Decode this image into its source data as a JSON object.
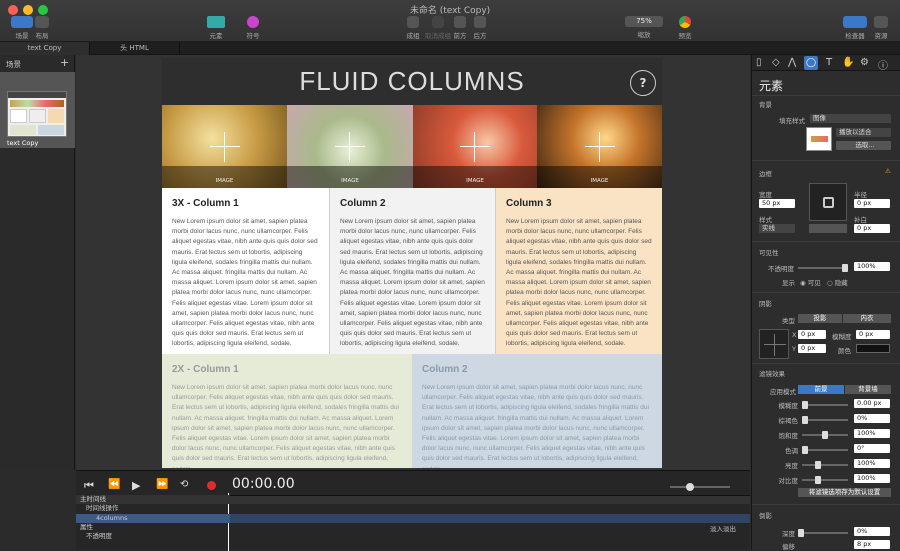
{
  "window": {
    "title": "未命名 (text Copy)"
  },
  "toolbar": {
    "scenes": "场景",
    "layout": "布局",
    "elements": "元素",
    "symbols": "符号",
    "group": "成组",
    "ungroup": "取消成组",
    "front": "前方",
    "back": "后方",
    "zoom_value": "75%",
    "zoom": "缩放",
    "preview": "预览",
    "inspector": "检查器",
    "library": "资源"
  },
  "tabs": [
    "text Copy",
    "头 HTML"
  ],
  "scenes_panel": {
    "title": "场景",
    "add": "+",
    "scene_name": "text Copy"
  },
  "page": {
    "title": "FLUID COLUMNS",
    "help": "?",
    "image_label": "IMAGE",
    "columns": [
      {
        "heading": "3X - Column 1",
        "text": "New Lorem ipsum dolor sit amet, sapien platea morbi dolor lacus nunc, nunc ullamcorper. Felis aliquet egestas vitae, nibh ante quis quis dolor sed mauris. Erat lectus sem ut lobortis, adipiscing ligula eleifend, sodales fringilla mattis dui nullam. Ac massa aliquet. fringilla mattis dui nullam. Ac massa aliquet. Lorem ipsum dolor sit amet, sapien platea morbi dolor lacus nunc, nunc ullamcorper. Felis aliquet egestas vitae. Lorem ipsum dolor sit amet, sapien platea morbi dolor lacus nunc, nunc ullamcorper. Felis aliquet egestas vitae, nibh ante quis quis dolor sed mauris. Erat lectus sem ut lobortis, adipiscing ligula eleifend, sodale."
      },
      {
        "heading": "Column 2",
        "text": "New Lorem ipsum dolor sit amet, sapien platea morbi dolor lacus nunc, nunc ullamcorper. Felis aliquet egestas vitae, nibh ante quis quis dolor sed mauris. Erat lectus sem ut lobortis, adipiscing ligula eleifend, sodales fringilla mattis dui nullam. Ac massa aliquet. fringilla mattis dui nullam. Ac massa aliquet. Lorem ipsum dolor sit amet, sapien platea morbi dolor lacus nunc, nunc ullamcorper. Felis aliquet egestas vitae. Lorem ipsum dolor sit amet, sapien platea morbi dolor lacus nunc, nunc ullamcorper. Felis aliquet egestas vitae, nibh ante quis quis dolor sed mauris. Erat lectus sem ut lobortis, adipiscing ligula eleifend, sodale."
      },
      {
        "heading": "Column 3",
        "text": "New Lorem ipsum dolor sit amet, sapien platea morbi dolor lacus nunc, nunc ullamcorper. Felis aliquet egestas vitae, nibh ante quis quis dolor sed mauris. Erat lectus sem ut lobortis, adipiscing ligula eleifend, sodales fringilla mattis dui nullam. Ac massa aliquet. fringilla mattis dui nullam. Ac massa aliquet. Lorem ipsum dolor sit amet, sapien platea morbi dolor lacus nunc, nunc ullamcorper. Felis aliquet egestas vitae. Lorem ipsum dolor sit amet, sapien platea morbi dolor lacus nunc, nunc ullamcorper. Felis aliquet egestas vitae, nibh ante quis quis dolor sed mauris. Erat lectus sem ut lobortis, adipiscing ligula eleifend, sodale."
      },
      {
        "heading": "2X - Column 1",
        "text": "New Lorem ipsum dolor sit amet, sapien platea morbi dolor lacus nunc, nunc ullamcorper. Felis aliquet egestas vitae, nibh ante quis quis dolor sed mauris. Erat lectus sem ut lobortis, adipiscing ligula eleifend, sodales fringilla mattis dui nullam. Ac massa aliquet. fringilla mattis dui nullam. Ac massa aliquet. Lorem ipsum dolor sit amet, sapien platea morbi dolor lacus nunc, nunc ullamcorper. Felis aliquet egestas vitae. Lorem ipsum dolor sit amet, sapien platea morbi dolor lacus nunc, nunc ullamcorper. Felis aliquet egestas vitae, nibh ante quis quis dolor sed mauris. Erat lectus sem ut lobortis, adipiscing ligula eleifend, sodale."
      },
      {
        "heading": "Column 2",
        "text": "New Lorem ipsum dolor sit amet, sapien platea morbi dolor lacus nunc, nunc ullamcorper. Felis aliquet egestas vitae, nibh ante quis quis dolor sed mauris. Erat lectus sem ut lobortis, adipiscing ligula eleifend, sodales fringilla mattis dui nullam. Ac massa aliquet. fringilla mattis dui nullam. Ac massa aliquet. Lorem ipsum dolor sit amet, sapien platea morbi dolor lacus nunc, nunc ullamcorper. Felis aliquet egestas vitae. Lorem ipsum dolor sit amet, sapien platea morbi dolor lacus nunc, nunc ullamcorper. Felis aliquet egestas vitae, nibh ante quis quis dolor sed mauris. Erat lectus sem ut lobortis, adipiscing ligula eleifend, sodale."
      }
    ]
  },
  "timeline": {
    "timecode": "00:00.00",
    "rows": [
      "主时间线",
      "时间线操作",
      "4columns",
      "属性",
      "不透明度"
    ],
    "transition": "淡入淡出"
  },
  "inspector": {
    "title": "元素",
    "background": "背景",
    "fill_style": "填充样式",
    "fill_value": "图像",
    "fit_value": "播放以适合",
    "choose": "选取...",
    "border": "边框",
    "width": "宽度",
    "width_value": "50 px",
    "style": "样式",
    "style_value": "实线",
    "radius": "半径",
    "radius_value": "0 px",
    "padding": "补白",
    "padding_value": "0 px",
    "visibility": "可见性",
    "opacity": "不透明度",
    "opacity_value": "100%",
    "display": "显示",
    "visible": "可见",
    "hidden": "隐藏",
    "shadow": "阴影",
    "type": "类型",
    "drop": "投影",
    "inner": "内衣",
    "x": "X",
    "x_value": "0 px",
    "blur": "模糊度",
    "blur_value": "0 px",
    "y": "Y",
    "y_value": "0 px",
    "color": "颜色",
    "filters": "滤镜效果",
    "apply_mode": "应用模式",
    "front": "前景",
    "back": "背景墙",
    "filter_rows": [
      {
        "label": "模糊度",
        "value": "0.00 px",
        "level": 0
      },
      {
        "label": "棕褐色",
        "value": "0%",
        "level": 0
      },
      {
        "label": "饱和度",
        "value": "100%",
        "level": 0.5
      },
      {
        "label": "色调",
        "value": "0°",
        "level": 0
      },
      {
        "label": "亮度",
        "value": "100%",
        "level": 0.33
      },
      {
        "label": "对比度",
        "value": "100%",
        "level": 0.33
      }
    ],
    "set_default": "将滤镜选项存为默认设置",
    "reflection": "倒影",
    "depth": "深度",
    "depth_value": "0%",
    "offset": "偏移",
    "offset_value": "8 px"
  },
  "colors": {
    "accent": "#3b78c8",
    "col3_bg": "#f9e3c4",
    "col4_bg": "#e6ebd8",
    "col5_bg": "#cdd8e3",
    "col2_bg": "#f2f2f2"
  }
}
